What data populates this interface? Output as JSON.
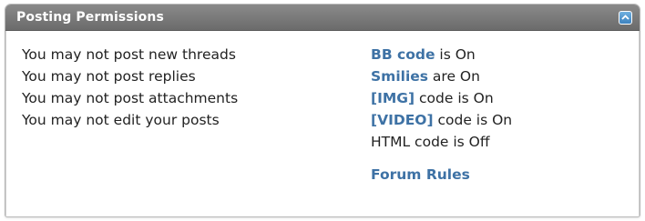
{
  "panel": {
    "title": "Posting Permissions",
    "collapse_icon": "chevron-up-icon"
  },
  "permissions": [
    "You may not post new threads",
    "You may not post replies",
    "You may not post attachments",
    "You may not edit your posts"
  ],
  "settings": [
    {
      "link": "BB code",
      "text": " is On"
    },
    {
      "link": "Smilies",
      "text": " are On"
    },
    {
      "link": "[IMG]",
      "text": " code is On"
    },
    {
      "link": "[VIDEO]",
      "text": " code is On"
    }
  ],
  "html_setting": "HTML code is Off",
  "forum_rules": "Forum Rules",
  "colors": {
    "header": "#7a7a7a",
    "link": "#3e72a5",
    "text": "#222222"
  }
}
